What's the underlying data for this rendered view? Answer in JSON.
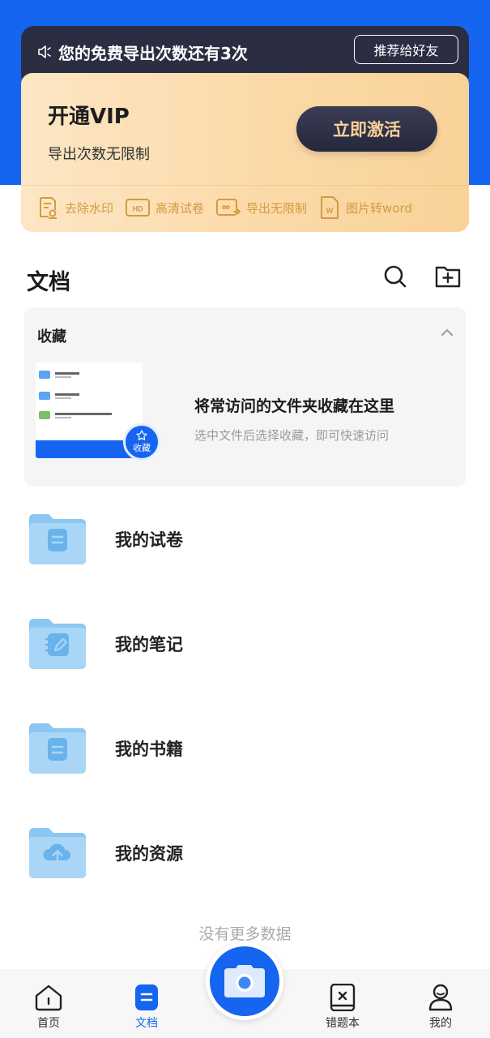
{
  "notice": {
    "text": "您的免费导出次数还有3次",
    "recommend_label": "推荐给好友"
  },
  "vip": {
    "title": "开通VIP",
    "subtitle": "导出次数无限制",
    "activate_label": "立即激活",
    "features": [
      {
        "label": "去除水印",
        "icon": "watermark-icon"
      },
      {
        "label": "高清试卷",
        "icon": "hd-icon"
      },
      {
        "label": "导出无限制",
        "icon": "export-icon"
      },
      {
        "label": "图片转word",
        "icon": "word-icon"
      }
    ]
  },
  "section": {
    "title": "文档"
  },
  "favorites": {
    "title": "收藏",
    "heading": "将常访问的文件夹收藏在这里",
    "description": "选中文件后选择收藏，即可快速访问",
    "badge_label": "收藏"
  },
  "folders": [
    {
      "label": "我的试卷",
      "icon": "document-folder-icon"
    },
    {
      "label": "我的笔记",
      "icon": "notes-folder-icon"
    },
    {
      "label": "我的书籍",
      "icon": "book-folder-icon"
    },
    {
      "label": "我的资源",
      "icon": "cloud-folder-icon"
    }
  ],
  "list_end": "没有更多数据",
  "tabbar": {
    "home": "首页",
    "docs": "文档",
    "mistakes": "错题本",
    "mine": "我的"
  },
  "colors": {
    "primary": "#1565f0",
    "vip_gold": "#d39a44",
    "notice_bg": "#2b2d42"
  }
}
